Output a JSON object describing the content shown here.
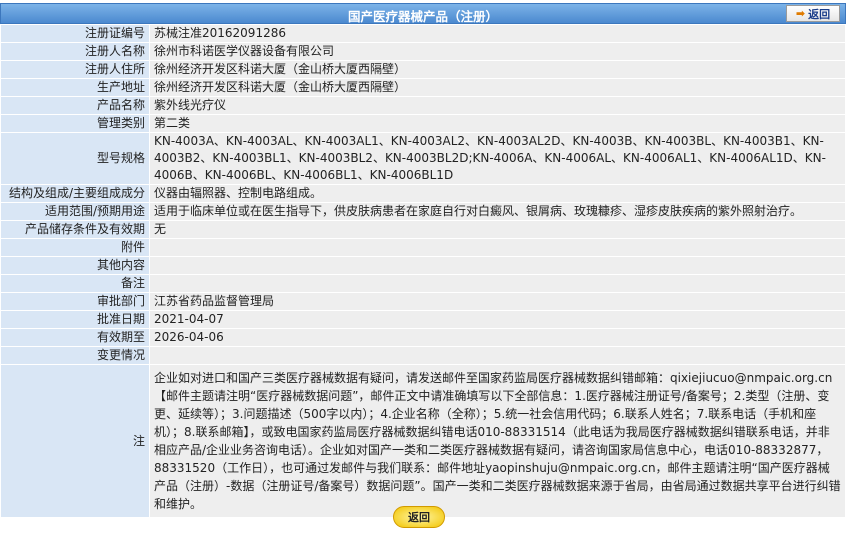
{
  "header": {
    "title": "国产医疗器械产品（注册）",
    "back_label": "返回"
  },
  "rows": [
    {
      "label": "注册证编号",
      "value": "苏械注准20162091286"
    },
    {
      "label": "注册人名称",
      "value": "徐州市科诺医学仪器设备有限公司"
    },
    {
      "label": "注册人住所",
      "value": "徐州经济开发区科诺大厦（金山桥大厦西隔壁）"
    },
    {
      "label": "生产地址",
      "value": "徐州经济开发区科诺大厦（金山桥大厦西隔壁）"
    },
    {
      "label": "产品名称",
      "value": "紫外线光疗仪"
    },
    {
      "label": "管理类别",
      "value": "第二类"
    },
    {
      "label": "型号规格",
      "value": "KN-4003A、KN-4003AL、KN-4003AL1、KN-4003AL2、KN-4003AL2D、KN-4003B、KN-4003BL、KN-4003B1、KN-4003B2、KN-4003BL1、KN-4003BL2、KN-4003BL2D;KN-4006A、KN-4006AL、KN-4006AL1、KN-4006AL1D、KN-4006B、KN-4006BL、KN-4006BL1、KN-4006BL1D"
    },
    {
      "label": "结构及组成/主要组成成分",
      "value": "仪器由辐照器、控制电路组成。"
    },
    {
      "label": "适用范围/预期用途",
      "value": "适用于临床单位或在医生指导下，供皮肤病患者在家庭自行对白癜风、银屑病、玫瑰糠疹、湿疹皮肤疾病的紫外照射治疗。"
    },
    {
      "label": "产品储存条件及有效期",
      "value": "无"
    },
    {
      "label": "附件",
      "value": ""
    },
    {
      "label": "其他内容",
      "value": ""
    },
    {
      "label": "备注",
      "value": ""
    },
    {
      "label": "审批部门",
      "value": "江苏省药品监督管理局"
    },
    {
      "label": "批准日期",
      "value": "2021-04-07"
    },
    {
      "label": "有效期至",
      "value": "2026-04-06"
    },
    {
      "label": "变更情况",
      "value": ""
    }
  ],
  "note": {
    "label": "注",
    "value": "企业如对进口和国产三类医疗器械数据有疑问，请发送邮件至国家药监局医疗器械数据纠错邮箱：qixiejiucuo@nmpaic.org.cn【邮件主题请注明“医疗器械数据问题”，邮件正文中请准确填写以下全部信息：1.医疗器械注册证号/备案号；2.类型（注册、变更、延续等）；3.问题描述（500字以内）；4.企业名称（全称）；5.统一社会信用代码；6.联系人姓名；7.联系电话（手机和座机）；8.联系邮箱】，或致电国家药监局医疗器械数据纠错电话010-88331514（此电话为我局医疗器械数据纠错联系电话，并非相应产品/企业业务咨询电话）。企业如对国产一类和二类医疗器械数据有疑问，请咨询国家局信息中心，电话010-88332877，88331520（工作日），也可通过发邮件与我们联系：邮件地址yaopinshuju@nmpaic.org.cn，邮件主题请注明“国产医疗器械产品（注册）-数据（注册证号/备案号）数据问题”。国产一类和二类医疗器械数据来源于省局，由省局通过数据共享平台进行纠错和维护。"
  },
  "footer": {
    "back_label": "返回"
  }
}
